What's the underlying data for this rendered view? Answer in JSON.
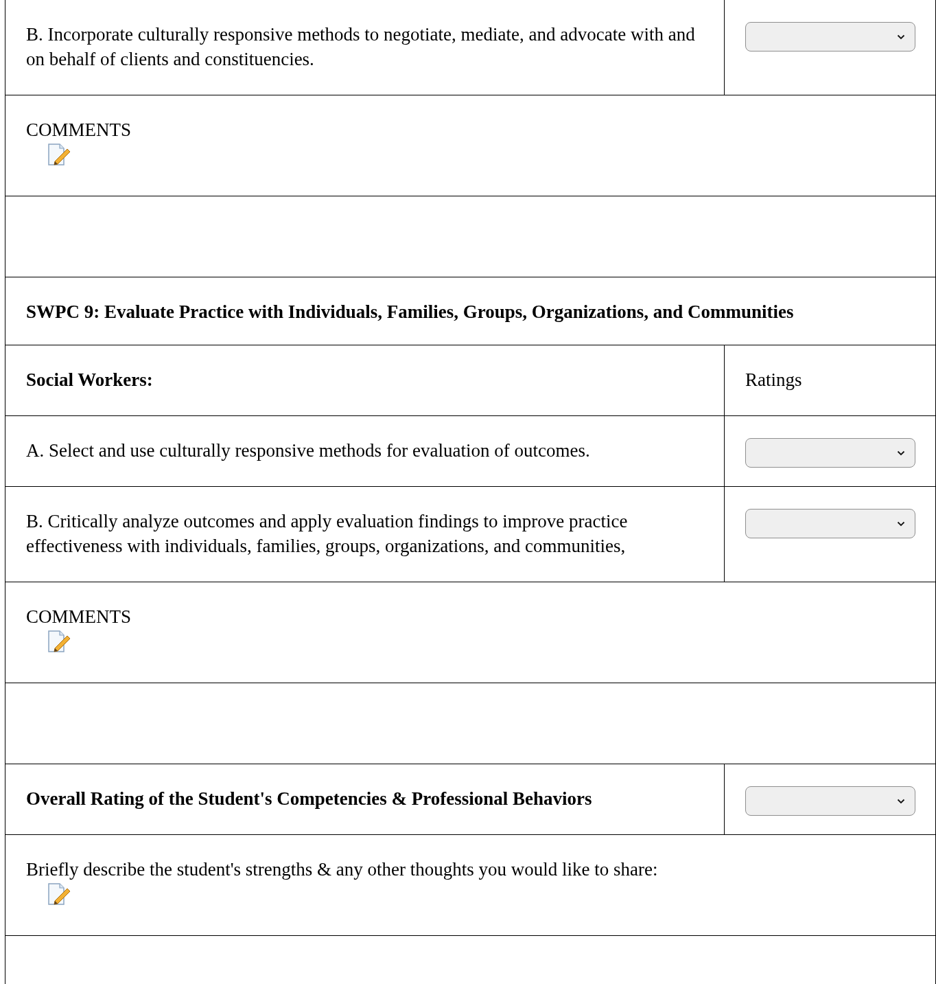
{
  "rows": [
    {
      "kind": "item",
      "text": "B. Incorporate culturally responsive methods to negotiate, mediate, and advocate with and on behalf of clients and constituencies."
    },
    {
      "kind": "comments",
      "text": "COMMENTS"
    },
    {
      "kind": "blank"
    },
    {
      "kind": "heading",
      "text": "SWPC 9: Evaluate Practice with Individuals, Families, Groups, Organizations, and Communities"
    },
    {
      "kind": "header",
      "text": "Social Workers:",
      "right": "Ratings"
    },
    {
      "kind": "item",
      "text": "A. Select and use culturally responsive methods for evaluation of outcomes."
    },
    {
      "kind": "item",
      "text": "B. Critically analyze outcomes and apply evaluation findings to improve practice effectiveness with individuals, families, groups, organizations, and communities,"
    },
    {
      "kind": "comments",
      "text": "COMMENTS"
    },
    {
      "kind": "blank"
    },
    {
      "kind": "overall",
      "text": "Overall Rating of the Student's Competencies & Professional Behaviors"
    },
    {
      "kind": "comments",
      "text": "Briefly describe the student's strengths & any other thoughts you would like to share:"
    }
  ]
}
